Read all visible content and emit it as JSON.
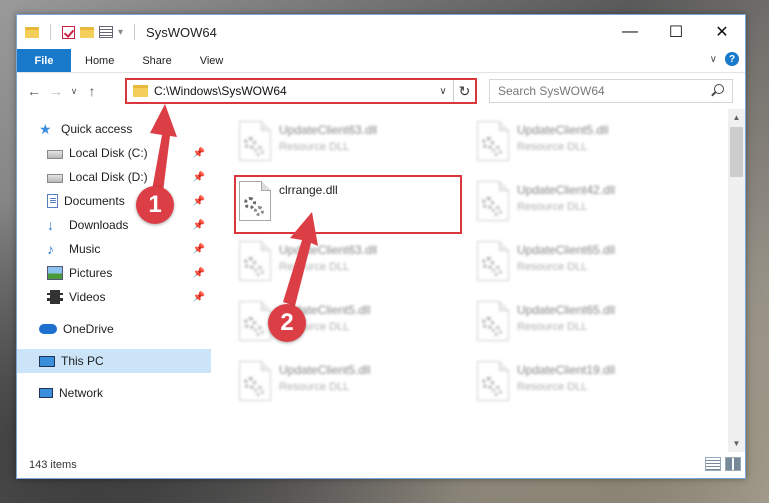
{
  "window": {
    "title": "SysWOW64",
    "minimize": "—",
    "maximize": "☐",
    "close": "✕"
  },
  "ribbon": {
    "file": "File",
    "tabs": [
      "Home",
      "Share",
      "View"
    ]
  },
  "address": {
    "path": "C:\\Windows\\SysWOW64",
    "search_placeholder": "Search SysWOW64"
  },
  "nav": {
    "quick_access": "Quick access",
    "items": [
      {
        "label": "Local Disk (C:)",
        "icon": "drive-icon"
      },
      {
        "label": "Local Disk (D:)",
        "icon": "drive-icon"
      },
      {
        "label": "Documents",
        "icon": "documents-icon"
      },
      {
        "label": "Downloads",
        "icon": "downloads-icon"
      },
      {
        "label": "Music",
        "icon": "music-icon"
      },
      {
        "label": "Pictures",
        "icon": "pictures-icon"
      },
      {
        "label": "Videos",
        "icon": "videos-icon"
      }
    ],
    "onedrive": "OneDrive",
    "this_pc": "This PC",
    "network": "Network"
  },
  "files": {
    "col1": [
      {
        "name": "UpdateClient63.dll",
        "type": "Resource DLL"
      },
      {
        "name": "clrrange.dll",
        "type": ""
      },
      {
        "name": "UpdateClient63.dll",
        "type": "Resource DLL"
      },
      {
        "name": "UpdateClient5.dll",
        "type": "Resource DLL"
      },
      {
        "name": "UpdateClient5.dll",
        "type": "Resource DLL"
      }
    ],
    "col2": [
      {
        "name": "UpdateClient5.dll",
        "type": "Resource DLL"
      },
      {
        "name": "UpdateClient42.dll",
        "type": "Resource DLL"
      },
      {
        "name": "UpdateClient65.dll",
        "type": "Resource DLL"
      },
      {
        "name": "UpdateClient65.dll",
        "type": "Resource DLL"
      },
      {
        "name": "UpdateClient19.dll",
        "type": "Resource DLL"
      }
    ]
  },
  "status": {
    "count": "143 items"
  },
  "callouts": [
    "1",
    "2"
  ],
  "colors": {
    "accent": "#1979ca",
    "annotation_red": "#dc3e45",
    "selected": "#cce4f7"
  }
}
